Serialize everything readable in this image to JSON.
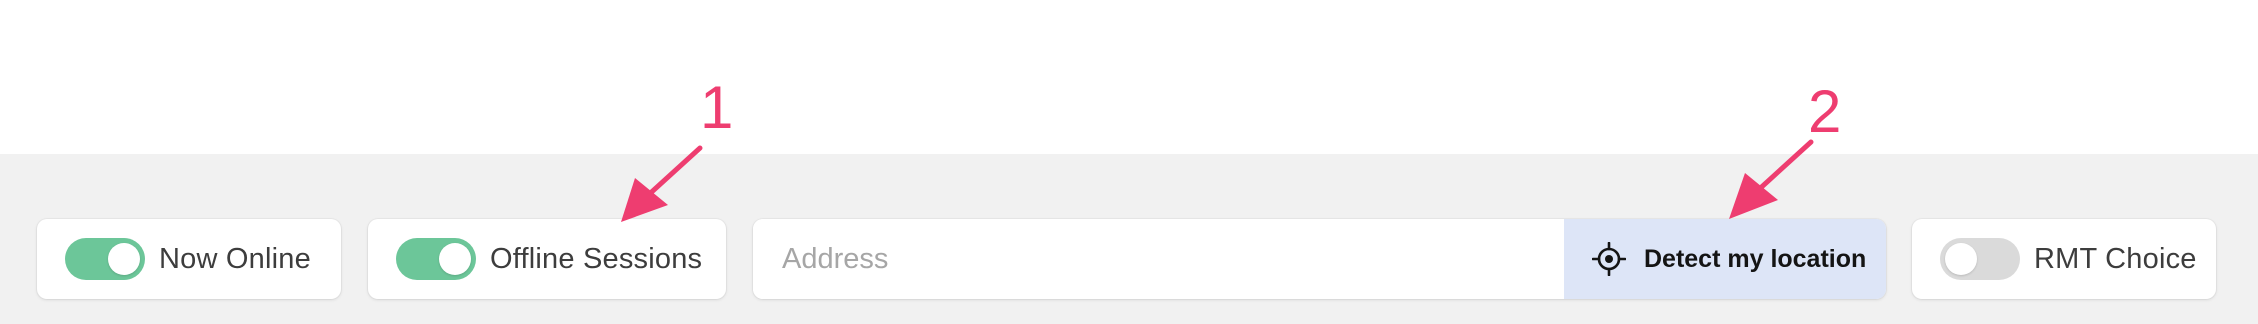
{
  "toolbar": {
    "now_online": {
      "label": "Now Online",
      "on": true,
      "icon": "toggle-switch-icon"
    },
    "offline_sessions": {
      "label": "Offline Sessions",
      "on": true,
      "icon": "toggle-switch-icon"
    },
    "address": {
      "value": "",
      "placeholder": "Address"
    },
    "detect_location": {
      "label": "Detect my location",
      "icon": "location-crosshair-icon"
    },
    "rmt_choice": {
      "label": "RMT Choice",
      "on": false,
      "icon": "toggle-switch-icon"
    }
  },
  "annotations": [
    {
      "number": "1"
    },
    {
      "number": "2"
    }
  ],
  "colors": {
    "toggle_on": "#6cc699",
    "toggle_off": "#dadada",
    "detect_button_bg": "#dde5f7",
    "annotation": "#ee3d70",
    "toolbar_band": "#f1f1f1"
  }
}
